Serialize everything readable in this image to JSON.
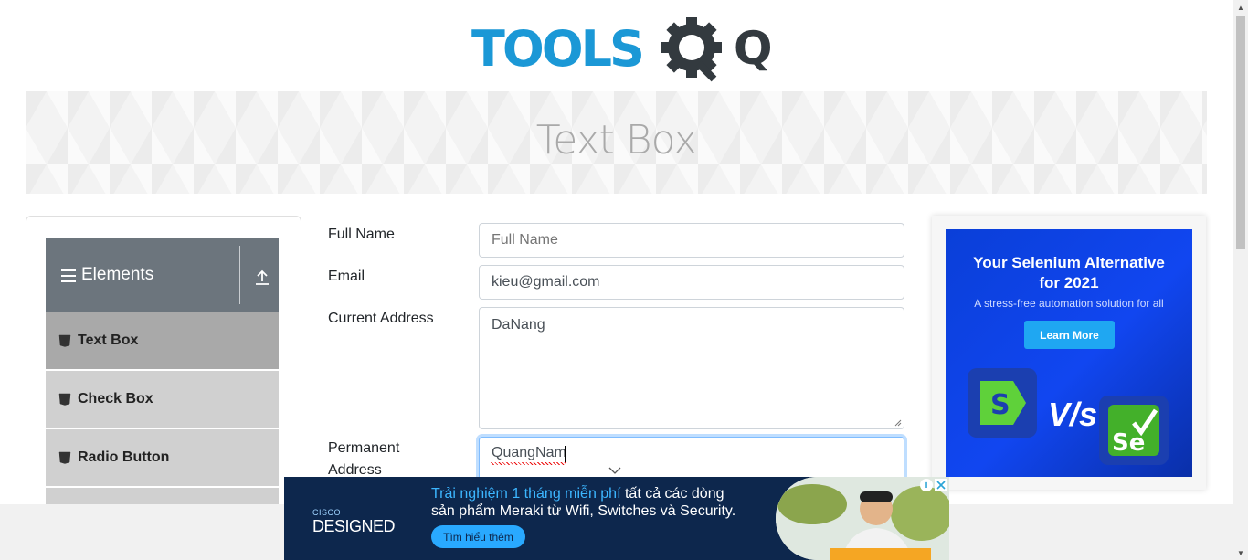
{
  "logo": {
    "text": "TOOLS",
    "accent": "QA"
  },
  "page": {
    "title": "Text Box"
  },
  "sidebar": {
    "group_title": "Elements",
    "items": [
      {
        "label": "Text Box",
        "active": true
      },
      {
        "label": "Check Box",
        "active": false
      },
      {
        "label": "Radio Button",
        "active": false
      }
    ]
  },
  "form": {
    "full_name": {
      "label": "Full Name",
      "placeholder": "Full Name",
      "value": ""
    },
    "email": {
      "label": "Email",
      "value": "kieu@gmail.com"
    },
    "current_address": {
      "label": "Current Address",
      "value": "DaNang"
    },
    "permanent_address": {
      "label_line1": "Permanent",
      "label_line2": "Address",
      "value": "QuangNam"
    }
  },
  "ad_right": {
    "headline_line1": "Your Selenium Alternative",
    "headline_line2": "for 2021",
    "subline": "A stress-free automation solution for all",
    "cta": "Learn More",
    "vs": "V/s",
    "logo_left": "S",
    "logo_right": "Se"
  },
  "ad_bottom": {
    "brand_small": "CISCO",
    "brand_big": "DESIGNED",
    "highlight": "Trải nghiệm 1 tháng miễn phí",
    "text_rest": " tất cả các dòng",
    "text_line2": "sản phẩm Meraki từ Wifi, Switches và Security.",
    "cta": "Tìm hiểu thêm"
  },
  "colors": {
    "brand_blue": "#1b98d6",
    "sidebar_header": "#6c757d",
    "active_item": "#a9a9a9"
  }
}
